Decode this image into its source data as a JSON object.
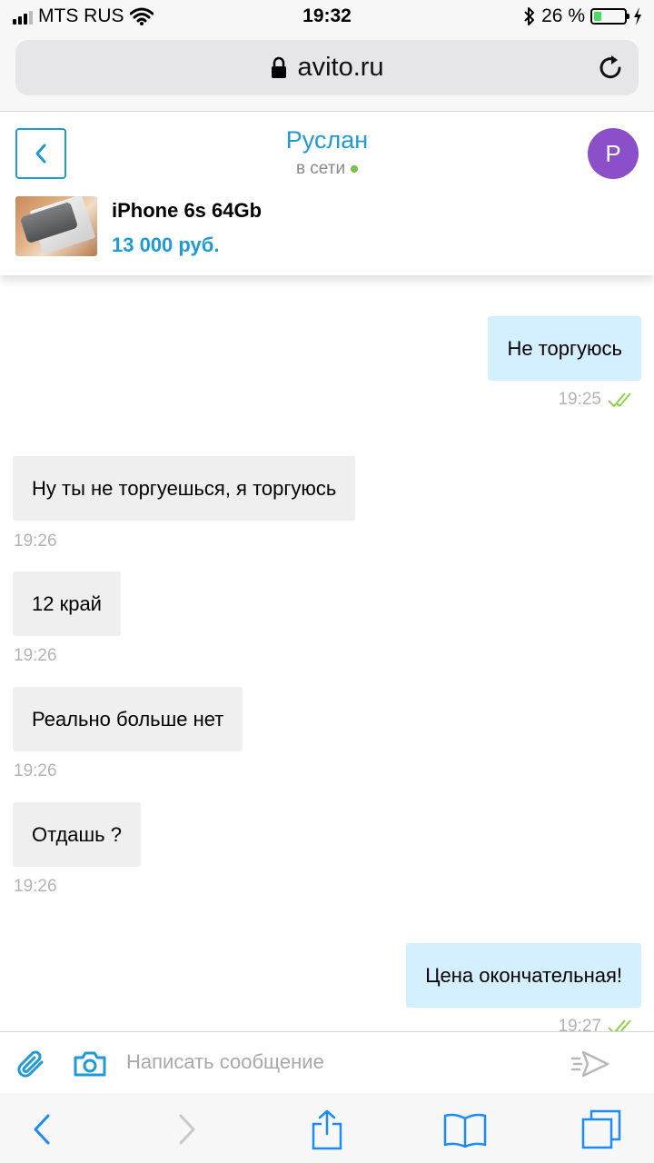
{
  "status_bar": {
    "carrier": "MTS RUS",
    "time": "19:32",
    "battery_text": "26 %",
    "battery_level": 0.26,
    "icons": [
      "signal-icon",
      "wifi-icon",
      "bluetooth-icon",
      "battery-icon",
      "charging-icon"
    ]
  },
  "browser": {
    "url": "avito.ru",
    "icons": [
      "lock-icon",
      "reload-icon"
    ]
  },
  "chat_header": {
    "contact_name": "Руслан",
    "contact_status": "в сети",
    "avatar_letter": "P",
    "item_title": "iPhone 6s 64Gb",
    "item_price": "13 000 руб.",
    "colors": {
      "accent": "#1e9ad6",
      "avatar": "#8b4fc9",
      "online": "#7ac143"
    }
  },
  "messages": [
    {
      "direction": "out",
      "text": "Не торгуюсь",
      "time": "19:25",
      "read": true
    },
    {
      "direction": "in",
      "text": "Ну ты не торгуешься, я торгуюсь",
      "time": "19:26"
    },
    {
      "direction": "in",
      "text": "12 край",
      "time": "19:26"
    },
    {
      "direction": "in",
      "text": "Реально больше нет",
      "time": "19:26"
    },
    {
      "direction": "in",
      "text": "Отдашь ?",
      "time": "19:26"
    },
    {
      "direction": "out",
      "text": "Цена окончательная!",
      "time": "19:27",
      "read": true
    }
  ],
  "composer": {
    "placeholder": "Написать сообщение",
    "icons": [
      "paperclip-icon",
      "camera-icon",
      "send-icon"
    ]
  },
  "toolbar": {
    "icons": [
      "back-arrow-icon",
      "forward-arrow-icon",
      "share-icon",
      "bookmarks-icon",
      "tabs-icon"
    ]
  },
  "colors": {
    "outgoing_bubble": "#d4efff",
    "incoming_bubble": "#efefef",
    "read_check": "#8fd14f",
    "ios_blue": "#1a8cff"
  }
}
